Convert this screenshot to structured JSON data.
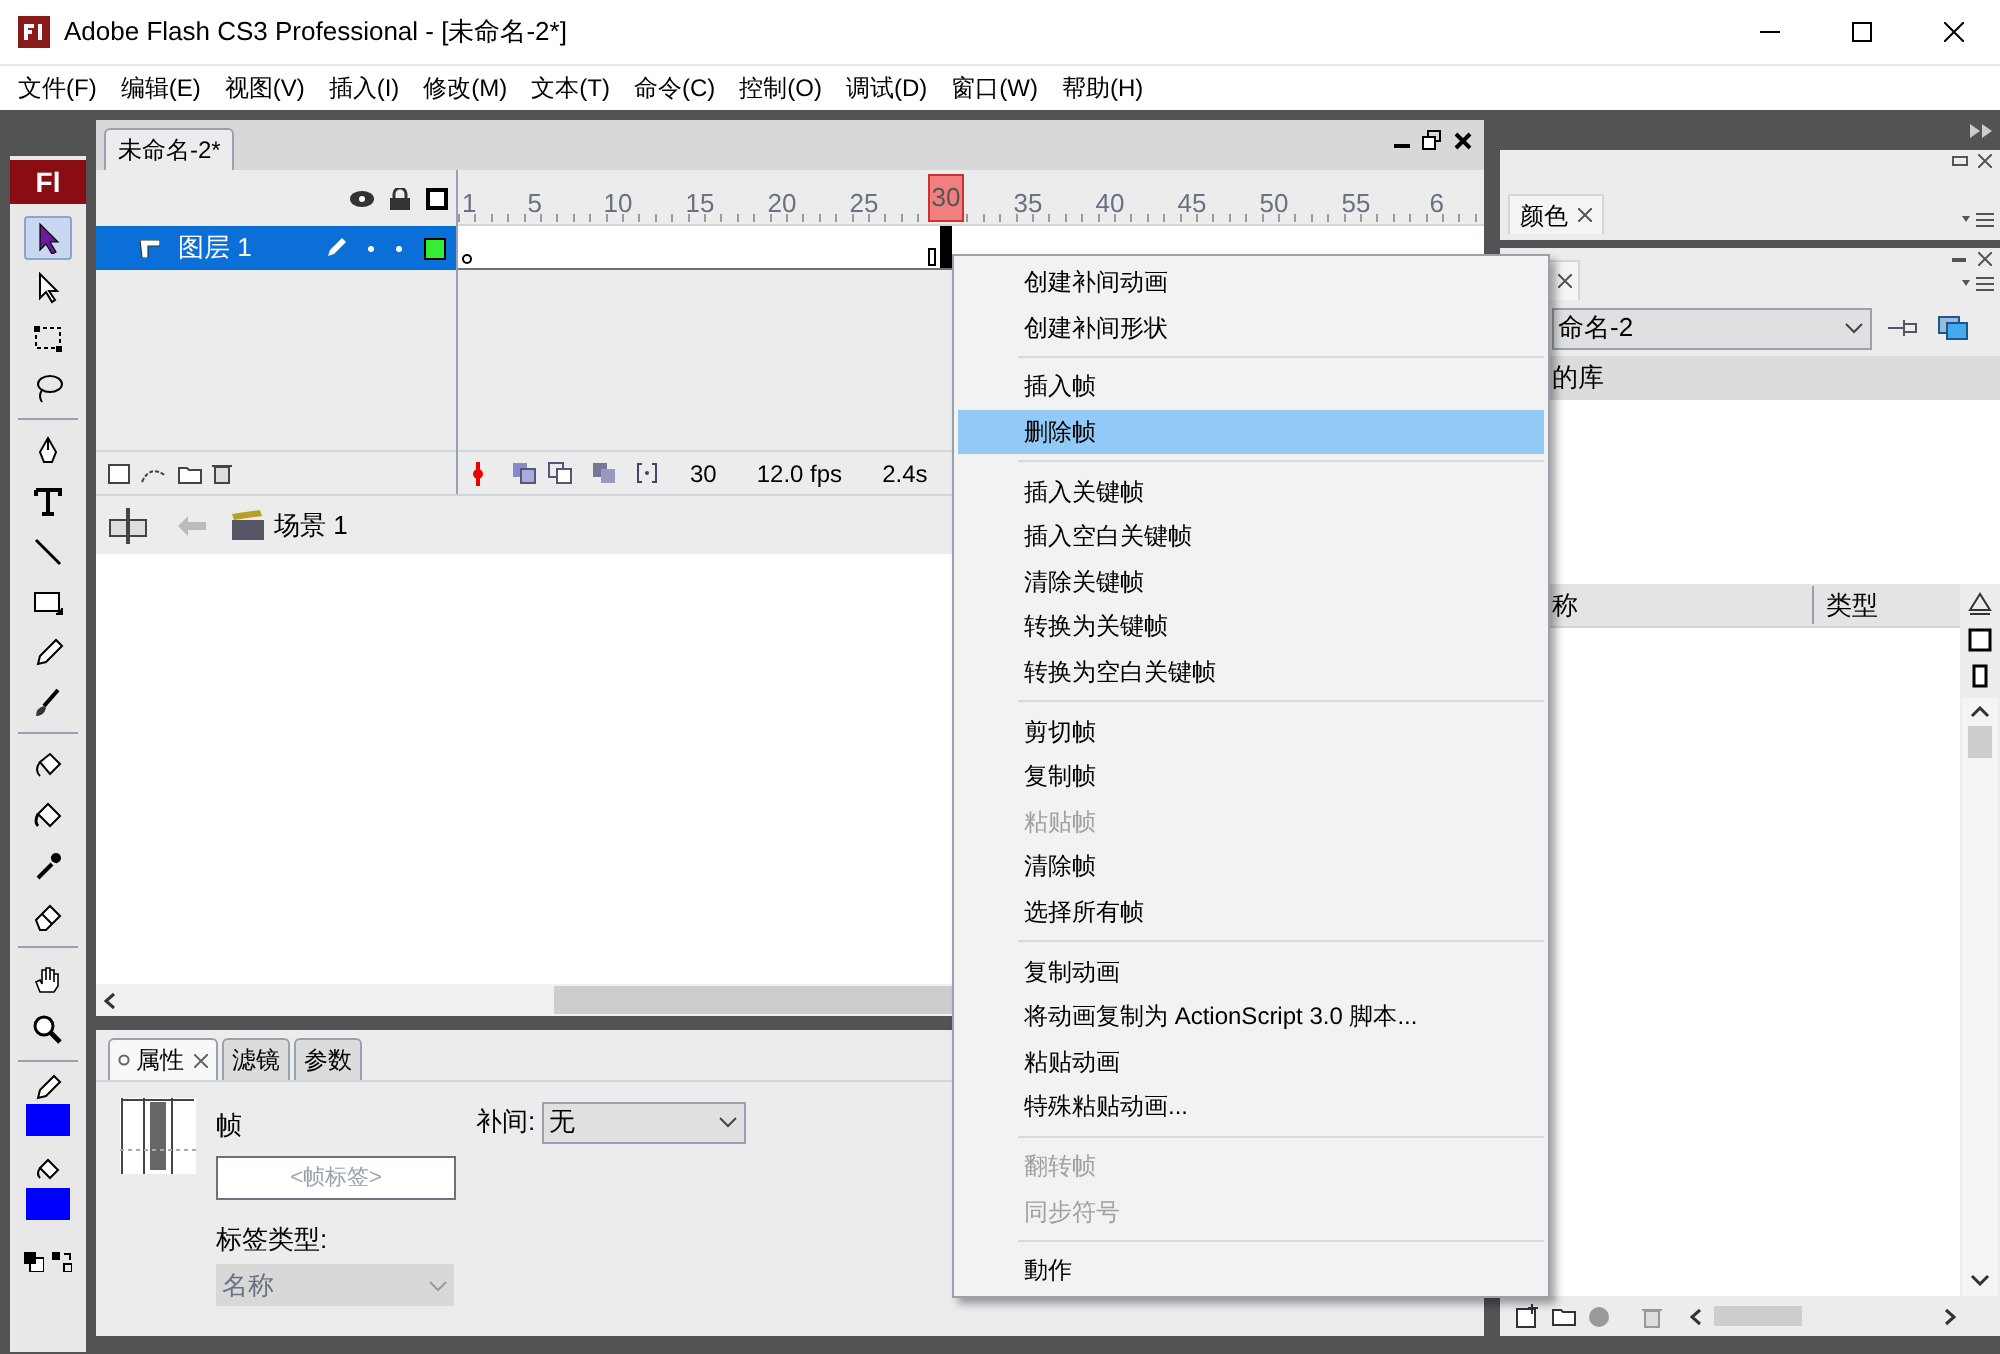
{
  "window": {
    "title": "Adobe Flash CS3 Professional - [未命名-2*]"
  },
  "menu_bar": [
    "文件(F)",
    "编辑(E)",
    "视图(V)",
    "插入(I)",
    "修改(M)",
    "文本(T)",
    "命令(C)",
    "控制(O)",
    "调试(D)",
    "窗口(W)",
    "帮助(H)"
  ],
  "tools_panel": {
    "logo": "Fl",
    "tools": [
      {
        "kind": "arrow",
        "selected": true
      },
      {
        "kind": "subselect",
        "selected": false
      },
      {
        "kind": "transform",
        "selected": false
      },
      {
        "kind": "lasso",
        "selected": false
      },
      {
        "kind": "pen",
        "selected": false
      },
      {
        "kind": "text",
        "selected": false
      },
      {
        "kind": "line",
        "selected": false
      },
      {
        "kind": "rect",
        "selected": false
      },
      {
        "kind": "pencil",
        "selected": false
      },
      {
        "kind": "brush",
        "selected": false
      },
      {
        "kind": "inkbottle",
        "selected": false
      },
      {
        "kind": "bucket",
        "selected": false
      },
      {
        "kind": "dropper",
        "selected": false
      },
      {
        "kind": "eraser",
        "selected": false
      },
      {
        "kind": "hand",
        "selected": false
      },
      {
        "kind": "zoom",
        "selected": false
      }
    ],
    "swatches": [
      {
        "kind": "stroke",
        "color": "#0000ff"
      },
      {
        "kind": "fill",
        "color": "#0000ff"
      }
    ]
  },
  "document": {
    "tab": "未命名-2*",
    "timeline": {
      "frame_numbers": [
        {
          "label": "1",
          "current": false
        },
        {
          "label": "5",
          "current": false
        },
        {
          "label": "10",
          "current": false
        },
        {
          "label": "15",
          "current": false
        },
        {
          "label": "20",
          "current": false
        },
        {
          "label": "25",
          "current": false
        },
        {
          "label": "30",
          "current": true
        },
        {
          "label": "35",
          "current": false
        },
        {
          "label": "40",
          "current": false
        },
        {
          "label": "45",
          "current": false
        },
        {
          "label": "50",
          "current": false
        },
        {
          "label": "55",
          "current": false
        },
        {
          "label": "6",
          "current": false
        }
      ],
      "layers": [
        {
          "name": "图层 1",
          "selected": true
        }
      ],
      "frame_count": "30",
      "frame_rate": "12.0 fps",
      "elapsed": "2.4s"
    },
    "scene": "场景 1"
  },
  "properties_panel": {
    "tabs": [
      {
        "label": "属性",
        "selected": true
      },
      {
        "label": "滤镜",
        "selected": false
      },
      {
        "label": "参数",
        "selected": false
      }
    ],
    "frame_label": "帧",
    "frame_label_field": {
      "placeholder": "<帧标签>"
    },
    "tween_label": "补间:",
    "tween_value": "无",
    "label_type_label": "标签类型:",
    "label_type_value": "名称"
  },
  "color_panel": {
    "tab": "颜色"
  },
  "library_panel": {
    "document": "命名-2",
    "caption": "的库",
    "columns": [
      "称",
      "类型"
    ]
  },
  "context_menu": [
    {
      "kind": "item",
      "label": "创建补间动画",
      "disabled": false,
      "selected": false
    },
    {
      "kind": "item",
      "label": "创建补间形状",
      "disabled": false,
      "selected": false
    },
    {
      "kind": "separator"
    },
    {
      "kind": "item",
      "label": "插入帧",
      "disabled": false,
      "selected": false
    },
    {
      "kind": "item",
      "label": "删除帧",
      "disabled": false,
      "selected": true
    },
    {
      "kind": "separator"
    },
    {
      "kind": "item",
      "label": "插入关键帧",
      "disabled": false,
      "selected": false
    },
    {
      "kind": "item",
      "label": "插入空白关键帧",
      "disabled": false,
      "selected": false
    },
    {
      "kind": "item",
      "label": "清除关键帧",
      "disabled": false,
      "selected": false
    },
    {
      "kind": "item",
      "label": "转换为关键帧",
      "disabled": false,
      "selected": false
    },
    {
      "kind": "item",
      "label": "转换为空白关键帧",
      "disabled": false,
      "selected": false
    },
    {
      "kind": "separator"
    },
    {
      "kind": "item",
      "label": "剪切帧",
      "disabled": false,
      "selected": false
    },
    {
      "kind": "item",
      "label": "复制帧",
      "disabled": false,
      "selected": false
    },
    {
      "kind": "item",
      "label": "粘贴帧",
      "disabled": true,
      "selected": false
    },
    {
      "kind": "item",
      "label": "清除帧",
      "disabled": false,
      "selected": false
    },
    {
      "kind": "item",
      "label": "选择所有帧",
      "disabled": false,
      "selected": false
    },
    {
      "kind": "separator"
    },
    {
      "kind": "item",
      "label": "复制动画",
      "disabled": false,
      "selected": false
    },
    {
      "kind": "item",
      "label": "将动画复制为 ActionScript 3.0 脚本...",
      "disabled": false,
      "selected": false
    },
    {
      "kind": "item",
      "label": "粘贴动画",
      "disabled": false,
      "selected": false
    },
    {
      "kind": "item",
      "label": "特殊粘贴动画...",
      "disabled": false,
      "selected": false
    },
    {
      "kind": "separator"
    },
    {
      "kind": "item",
      "label": "翻转帧",
      "disabled": true,
      "selected": false
    },
    {
      "kind": "item",
      "label": "同步符号",
      "disabled": true,
      "selected": false
    },
    {
      "kind": "separator"
    },
    {
      "kind": "item",
      "label": "動作",
      "disabled": false,
      "selected": false
    }
  ]
}
